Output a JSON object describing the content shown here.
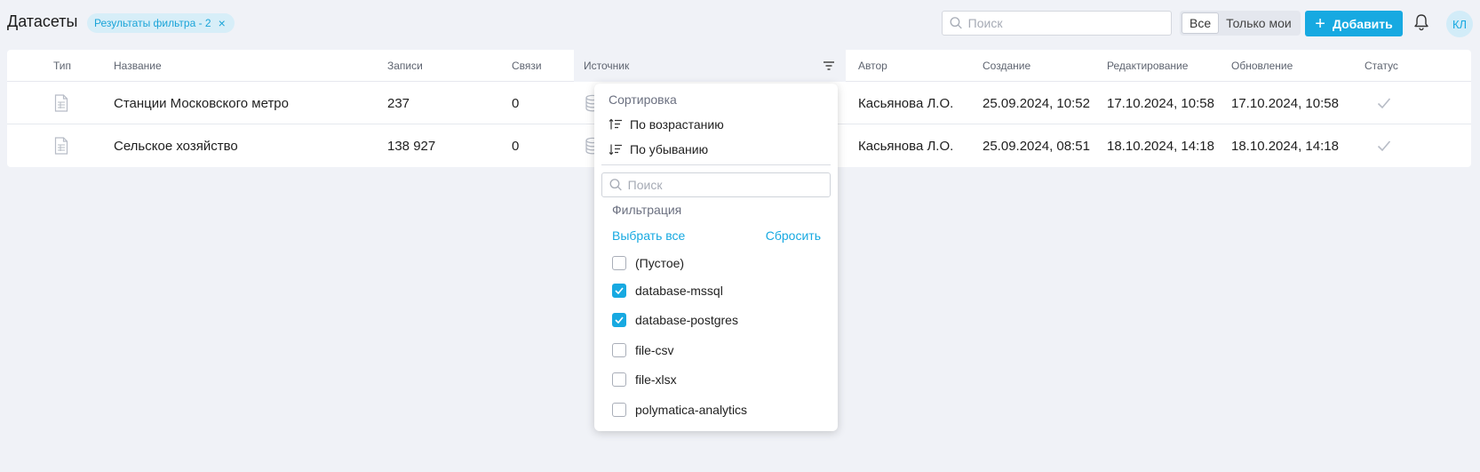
{
  "header": {
    "title": "Датасеты",
    "filter_chip": "Результаты фильтра - 2",
    "search_placeholder": "Поиск",
    "toggle_all": "Все",
    "toggle_mine": "Только мои",
    "add_button": "Добавить",
    "avatar_initials": "КЛ"
  },
  "table": {
    "columns": [
      "Тип",
      "Название",
      "Записи",
      "Связи",
      "Источник",
      "Автор",
      "Создание",
      "Редактирование",
      "Обновление",
      "Статус"
    ],
    "rows": [
      {
        "type_icon": "file-table-icon",
        "name": "Станции Московского метро",
        "records": "237",
        "links": "0",
        "source_icon": "database-icon",
        "author": "Касьянова Л.О.",
        "created": "25.09.2024, 10:52",
        "edited": "17.10.2024, 10:58",
        "updated": "17.10.2024, 10:58",
        "status_icon": "check-icon"
      },
      {
        "type_icon": "file-table-icon",
        "name": "Сельское хозяйство",
        "records": "138 927",
        "links": "0",
        "source_icon": "database-icon",
        "author": "Касьянова Л.О.",
        "created": "25.09.2024, 08:51",
        "edited": "18.10.2024, 14:18",
        "updated": "18.10.2024, 14:18",
        "status_icon": "check-icon"
      }
    ]
  },
  "dropdown": {
    "sort_title": "Сортировка",
    "sort_asc": "По возрастанию",
    "sort_desc": "По убыванию",
    "search_placeholder": "Поиск",
    "filter_title": "Фильтрация",
    "select_all": "Выбрать все",
    "reset": "Сбросить",
    "options": [
      {
        "label": "(Пустое)",
        "checked": false
      },
      {
        "label": "database-mssql",
        "checked": true
      },
      {
        "label": "database-postgres",
        "checked": true
      },
      {
        "label": "file-csv",
        "checked": false
      },
      {
        "label": "file-xlsx",
        "checked": false
      },
      {
        "label": "polymatica-analytics",
        "checked": false
      }
    ]
  },
  "colors": {
    "accent": "#17a9e1",
    "background": "#f0f2f7",
    "chip_bg": "#d7eef8"
  }
}
